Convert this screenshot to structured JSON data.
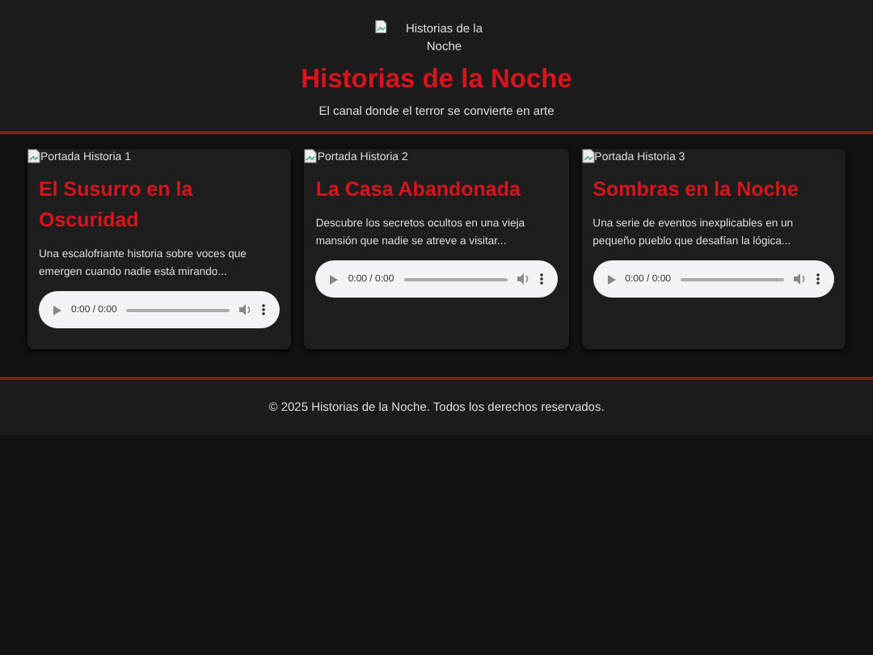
{
  "header": {
    "logo_alt": "Historias de la Noche",
    "title": "Historias de la Noche",
    "tagline": "El canal donde el terror se convierte en arte"
  },
  "stories": [
    {
      "cover_alt": "Portada Historia 1",
      "title": "El Susurro en la Oscuridad",
      "description": "Una escalofriante historia sobre voces que emergen cuando nadie está mirando...",
      "player": {
        "time": "0:00 / 0:00",
        "level": 0
      }
    },
    {
      "cover_alt": "Portada Historia 2",
      "title": "La Casa Abandonada",
      "description": "Descubre los secretos ocultos en una vieja mansión que nadie se atreve a visitar...",
      "player": {
        "time": "0:00 / 0:00",
        "level": 0
      }
    },
    {
      "cover_alt": "Portada Historia 3",
      "title": "Sombras en la Noche",
      "description": "Una serie de eventos inexplicables en un pequeño pueblo que desafían la lógica...",
      "player": {
        "time": "0:00 / 0:00",
        "level": 0
      }
    }
  ],
  "footer": {
    "text": "© 2025 Historias de la Noche. Todos los derechos reservados."
  }
}
